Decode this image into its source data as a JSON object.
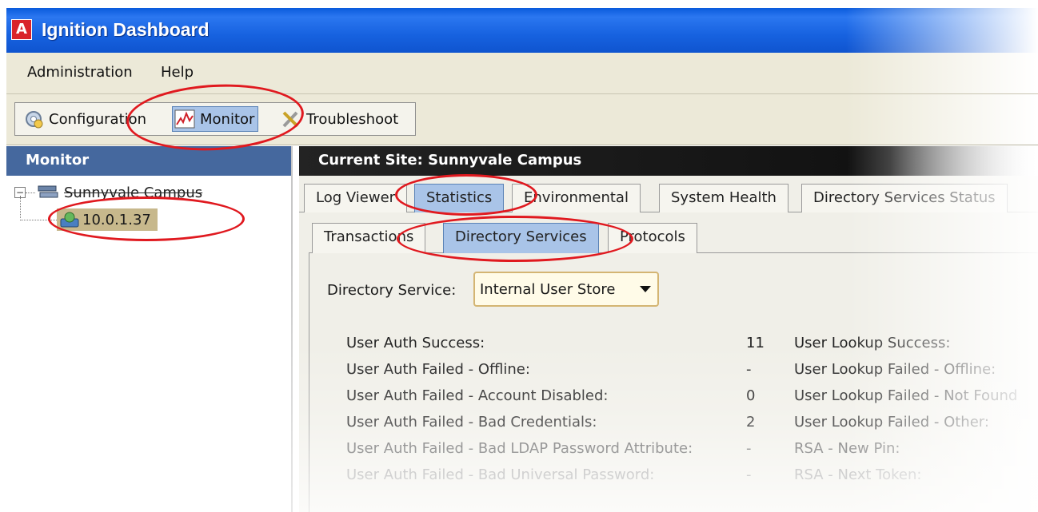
{
  "window": {
    "title": "Ignition Dashboard",
    "logo_letter": "A"
  },
  "menu": {
    "administration": "Administration",
    "help": "Help"
  },
  "toolbar": {
    "configuration": "Configuration",
    "monitor": "Monitor",
    "troubleshoot": "Troubleshoot"
  },
  "left_panel": {
    "header": "Monitor",
    "tree": {
      "root": "Sunnyvale Campus",
      "child": "10.0.1.37"
    }
  },
  "right_panel": {
    "header": "Current Site:  Sunnyvale Campus",
    "tabs": [
      "Log Viewer",
      "Statistics",
      "Environmental",
      "System Health",
      "Directory Services Status"
    ],
    "subtabs": [
      "Transactions",
      "Directory Services",
      "Protocols"
    ],
    "directory_service_label": "Directory Service:",
    "directory_service_value": "Internal User Store",
    "stats_left": [
      {
        "label": "User Auth Success:",
        "value": "11"
      },
      {
        "label": "User Auth Failed - Offline:",
        "value": "-"
      },
      {
        "label": "User Auth Failed - Account Disabled:",
        "value": "0"
      },
      {
        "label": "User Auth Failed - Bad Credentials:",
        "value": "2"
      },
      {
        "label": "User Auth Failed - Bad LDAP Password Attribute:",
        "value": "-"
      },
      {
        "label": "User Auth Failed - Bad Universal Password:",
        "value": "-"
      }
    ],
    "stats_right": [
      "User Lookup Success:",
      "User Lookup Failed - Offline:",
      "User Lookup Failed - Not Found",
      "User Lookup Failed - Other:",
      "RSA - New Pin:",
      "RSA - Next Token:"
    ]
  },
  "colors": {
    "title_bar": "#1762e0",
    "selected_blue": "#a9c4e8",
    "annotation_red": "#e0191f",
    "left_header": "#45689e"
  }
}
